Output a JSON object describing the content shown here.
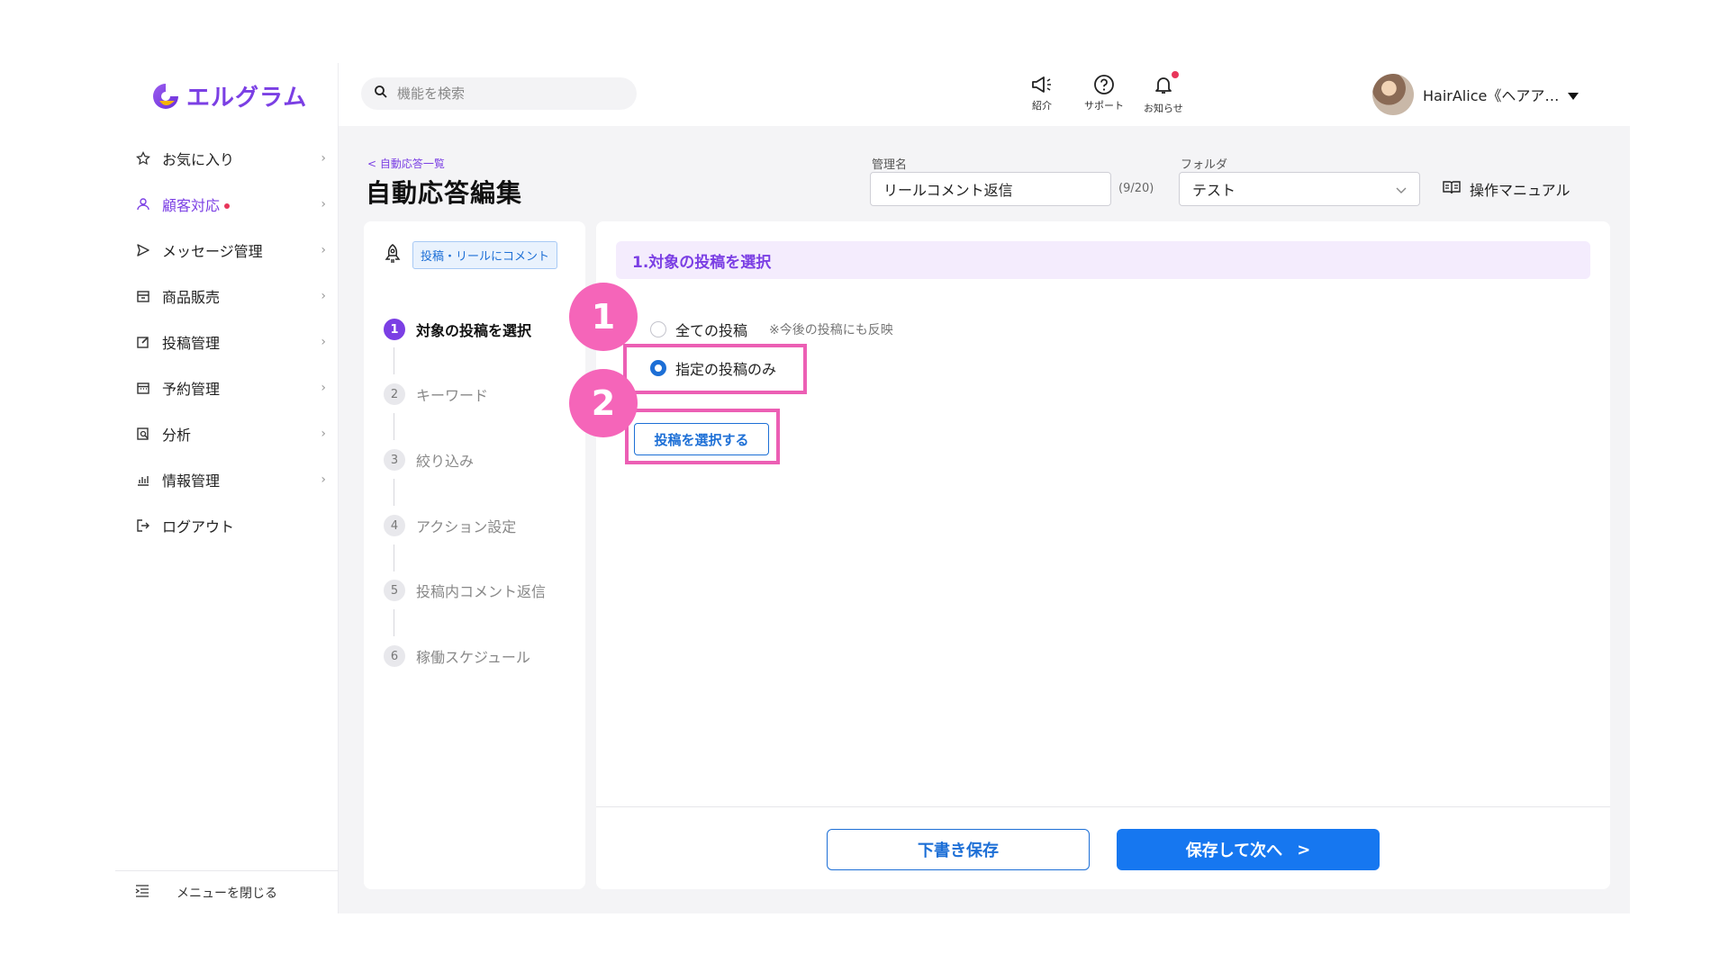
{
  "brand": {
    "name": "エルグラム",
    "accent": "#7b3fe4"
  },
  "header": {
    "search_placeholder": "機能を検索",
    "icons": [
      {
        "label": "紹介",
        "icon": "megaphone-icon"
      },
      {
        "label": "サポート",
        "icon": "help-icon"
      },
      {
        "label": "お知らせ",
        "icon": "bell-icon"
      }
    ],
    "user_name": "HairAlice《ヘアア…"
  },
  "sidebar": {
    "items": [
      {
        "label": "お気に入り",
        "icon": "star-icon"
      },
      {
        "label": "顧客対応",
        "icon": "user-icon",
        "active": true
      },
      {
        "label": "メッセージ管理",
        "icon": "send-icon"
      },
      {
        "label": "商品販売",
        "icon": "store-icon"
      },
      {
        "label": "投稿管理",
        "icon": "edit-icon"
      },
      {
        "label": "予約管理",
        "icon": "calendar-icon"
      },
      {
        "label": "分析",
        "icon": "analysis-icon"
      },
      {
        "label": "情報管理",
        "icon": "chart-icon"
      },
      {
        "label": "ログアウト",
        "icon": "logout-icon"
      }
    ],
    "close_label": "メニューを閉じる"
  },
  "page": {
    "breadcrumb": "< 自動応答一覧",
    "title": "自動応答編集",
    "name_label": "管理名",
    "name_value": "リールコメント返信",
    "name_counter": "(9/20)",
    "folder_label": "フォルダ",
    "folder_value": "テスト",
    "manual_label": "操作マニュアル"
  },
  "steps": {
    "trigger_label": "投稿・リールにコメント",
    "items": [
      {
        "num": "1",
        "label": "対象の投稿を選択",
        "active": true
      },
      {
        "num": "2",
        "label": "キーワード"
      },
      {
        "num": "3",
        "label": "絞り込み"
      },
      {
        "num": "4",
        "label": "アクション設定"
      },
      {
        "num": "5",
        "label": "投稿内コメント返信"
      },
      {
        "num": "6",
        "label": "稼働スケジュール"
      }
    ]
  },
  "content": {
    "section_title": "1.対象の投稿を選択",
    "option_all": "全ての投稿",
    "option_all_note": "※今後の投稿にも反映",
    "option_specific": "指定の投稿のみ",
    "selected_option": "指定の投稿のみ",
    "select_button": "投稿を選択する",
    "markers": [
      "1",
      "2"
    ],
    "draft_button": "下書き保存",
    "next_button": "保存して次へ",
    "next_arrow": ">"
  },
  "colors": {
    "primary": "#1677f0",
    "highlight": "#ec5fb4",
    "marker": "#f565b9",
    "notification": "#e8365a"
  }
}
